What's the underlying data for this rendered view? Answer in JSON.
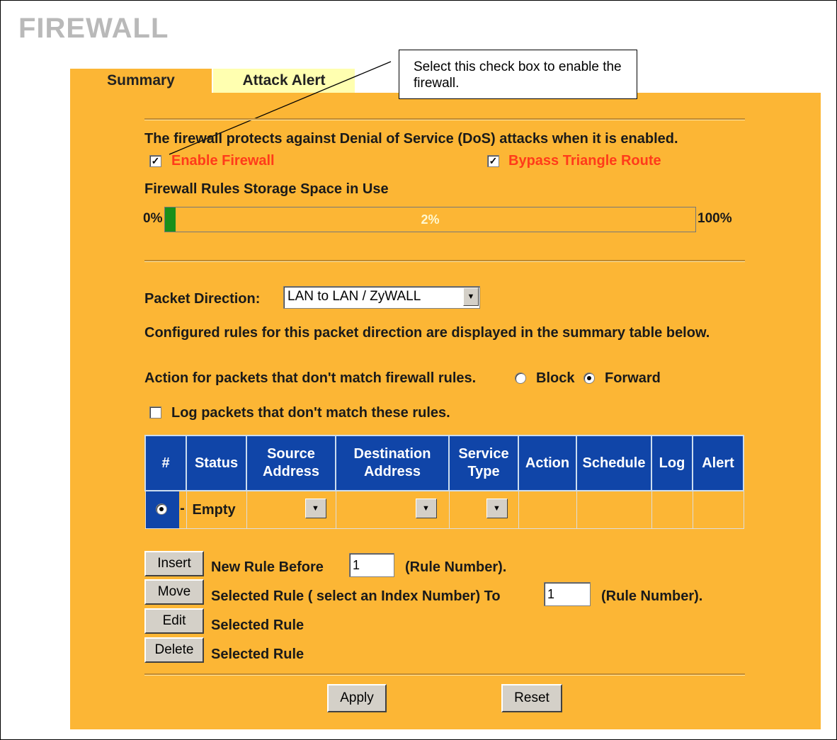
{
  "page": {
    "title": "FIREWALL"
  },
  "tabs": [
    {
      "label": "Summary",
      "selected": true
    },
    {
      "label": "Attack Alert",
      "selected": false
    }
  ],
  "callout": {
    "text": "Select this check box to enable the firewall."
  },
  "firewall": {
    "description": "The firewall protects against Denial of Service (DoS) attacks when it is enabled.",
    "enable_label": "Enable Firewall",
    "enable_checked": true,
    "bypass_label": "Bypass Triangle Route",
    "bypass_checked": true
  },
  "storage": {
    "label": "Firewall Rules Storage Space in Use",
    "min_label": "0%",
    "max_label": "100%",
    "value_label": "2%",
    "value_fraction": 0.02,
    "fill_color": "#1a8f1a"
  },
  "packet_direction": {
    "label": "Packet Direction:",
    "selected": "LAN to LAN / ZyWALL"
  },
  "info_text": "Configured rules for this packet direction are displayed in the summary table below.",
  "action": {
    "label": "Action for packets that don't match firewall rules.",
    "options": [
      {
        "label": "Block",
        "selected": false
      },
      {
        "label": "Forward",
        "selected": true
      }
    ]
  },
  "log_option": {
    "label": "Log packets that don't match these rules.",
    "checked": false
  },
  "rules_table": {
    "headers": [
      "#",
      "Status",
      "Source Address",
      "Destination Address",
      "Service Type",
      "Action",
      "Schedule",
      "Log",
      "Alert"
    ],
    "rows": [
      {
        "index_selected": true,
        "dash": "-",
        "status": "Empty"
      }
    ]
  },
  "rule_actions": {
    "insert": {
      "button": "Insert",
      "text": "New Rule Before",
      "value": "1",
      "suffix": "(Rule Number)."
    },
    "move": {
      "button": "Move",
      "text": "Selected Rule ( select an Index Number) To",
      "value": "1",
      "suffix": "(Rule Number)."
    },
    "edit": {
      "button": "Edit",
      "text": "Selected Rule"
    },
    "delete": {
      "button": "Delete",
      "text": "Selected Rule"
    }
  },
  "footer": {
    "apply": "Apply",
    "reset": "Reset"
  },
  "colors": {
    "panel": "#fcb635",
    "alert_tab": "#ffffb0",
    "table_header": "#1045a8",
    "highlight_text": "#ff3b1a"
  }
}
